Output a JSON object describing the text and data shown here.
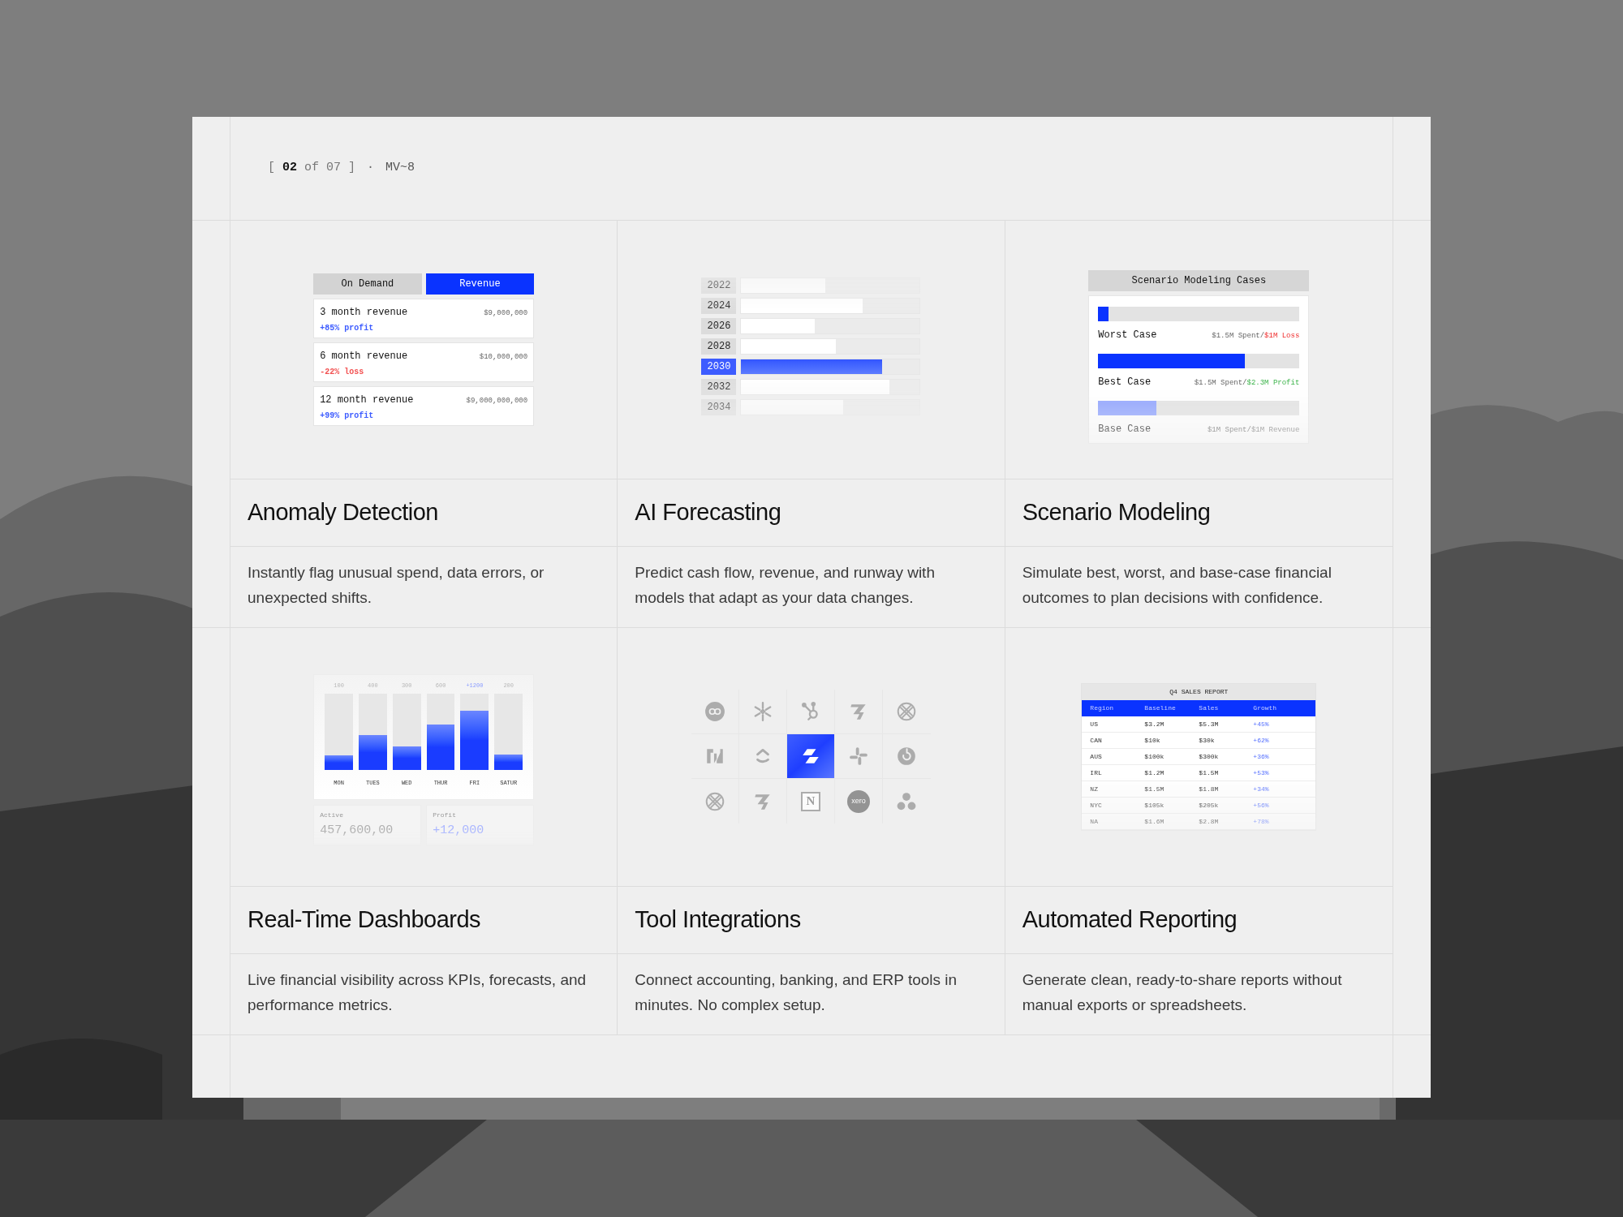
{
  "pager": {
    "text": "[ **02** of 07 ]",
    "separator": "·",
    "code": "MV~8"
  },
  "features": [
    {
      "title": "Anomaly Detection",
      "description": "Instantly flag unusual spend, data errors, or unexpected shifts.",
      "illustration": {
        "kind": "revenue-tabs",
        "tabs": [
          {
            "label": "On Demand",
            "selected": false
          },
          {
            "label": "Revenue",
            "selected": true
          }
        ],
        "rows": [
          {
            "label": "3 month revenue",
            "amount": "$9,000,000",
            "change": "+85% profit",
            "color": "#3d5cff"
          },
          {
            "label": "6 month revenue",
            "amount": "$10,000,000",
            "change": "-22% loss",
            "color": "#f25050"
          },
          {
            "label": "12 month revenue",
            "amount": "$9,000,000,000",
            "change": "+99% profit",
            "color": "#3d5cff"
          }
        ]
      }
    },
    {
      "title": "AI Forecasting",
      "description": "Predict cash flow, revenue, and runway with models that adapt as your data changes.",
      "illustration": {
        "kind": "year-bars",
        "years": [
          {
            "label": "2022",
            "level": 0.47,
            "selected": false
          },
          {
            "label": "2024",
            "level": 0.68,
            "selected": false
          },
          {
            "label": "2026",
            "level": 0.41,
            "selected": false
          },
          {
            "label": "2028",
            "level": 0.53,
            "selected": false
          },
          {
            "label": "2030",
            "level": 0.79,
            "selected": true
          },
          {
            "label": "2032",
            "level": 0.83,
            "selected": false
          },
          {
            "label": "2034",
            "level": 0.57,
            "selected": false
          }
        ]
      }
    },
    {
      "title": "Scenario Modeling",
      "description": "Simulate best, worst, and base-case financial outcomes to plan decisions with confidence.",
      "illustration": {
        "kind": "scenarios",
        "title": "Scenario Modeling Cases",
        "cases": [
          {
            "name": "Worst Case",
            "spent": "$1.5M Spent/",
            "result": "$1M Loss",
            "kind": "loss",
            "level": 0.05
          },
          {
            "name": "Best Case",
            "spent": "$1.5M Spent/",
            "result": "$2.3M Profit",
            "kind": "profit",
            "level": 0.73
          },
          {
            "name": "Base Case",
            "spent": "$1M Spent/",
            "result": "$1M Revenue",
            "kind": "revenue",
            "level": 0.29
          }
        ]
      }
    },
    {
      "title": "Real-Time Dashboards",
      "description": "Live financial visibility across KPIs, forecasts, and performance metrics.",
      "illustration": {
        "kind": "day-bars",
        "bars": [
          {
            "value": "100",
            "day": "MON",
            "level": 0.19,
            "highlighted": false
          },
          {
            "value": "400",
            "day": "TUES",
            "level": 0.46,
            "highlighted": false
          },
          {
            "value": "300",
            "day": "WED",
            "level": 0.31,
            "highlighted": false
          },
          {
            "value": "600",
            "day": "THUR",
            "level": 0.6,
            "highlighted": false
          },
          {
            "value": "+1200",
            "day": "FRI",
            "level": 0.78,
            "highlighted": true
          },
          {
            "value": "200",
            "day": "SATUR",
            "level": 0.2,
            "highlighted": false
          }
        ],
        "stats": [
          {
            "label": "Active",
            "value": "457,600,00",
            "highlighted": false
          },
          {
            "label": "Profit",
            "value": "+12,000",
            "highlighted": true
          }
        ]
      }
    },
    {
      "title": "Tool Integrations",
      "description": "Connect accounting, banking, and ERP tools in minutes. No complex setup.",
      "illustration": {
        "kind": "logo-grid",
        "tiles": [
          {
            "kind": "circle-badge",
            "selected": false
          },
          {
            "kind": "snowflake",
            "selected": false
          },
          {
            "kind": "hub",
            "selected": false
          },
          {
            "kind": "z-mark",
            "selected": false
          },
          {
            "kind": "lattice",
            "selected": false
          },
          {
            "kind": "bracket-mark",
            "selected": false
          },
          {
            "kind": "chevrons",
            "selected": false
          },
          {
            "kind": "app-mark",
            "selected": true
          },
          {
            "kind": "pinwheel",
            "selected": false
          },
          {
            "kind": "circle-arrow",
            "selected": false
          },
          {
            "kind": "lattice",
            "selected": false
          },
          {
            "kind": "z-mark",
            "selected": false
          },
          {
            "kind": "letter-tile",
            "label": "N",
            "selected": false
          },
          {
            "kind": "word-circle",
            "label": "xero",
            "selected": false
          },
          {
            "kind": "dots",
            "selected": false
          }
        ]
      }
    },
    {
      "title": "Automated Reporting",
      "description": "Generate clean, ready-to-share reports without manual exports or spreadsheets.",
      "illustration": {
        "kind": "report-table",
        "title": "Q4 SALES REPORT",
        "columns": [
          "Region",
          "Baseline",
          "Sales",
          "Growth"
        ],
        "rows": [
          [
            "US",
            "$3.2M",
            "$5.3M",
            "+45%"
          ],
          [
            "CAN",
            "$10k",
            "$30k",
            "+62%"
          ],
          [
            "AUS",
            "$100k",
            "$300k",
            "+36%"
          ],
          [
            "IRL",
            "$1.2M",
            "$1.5M",
            "+53%"
          ],
          [
            "NZ",
            "$1.5M",
            "$1.8M",
            "+34%"
          ],
          [
            "NYC",
            "$105k",
            "$205k",
            "+56%"
          ],
          [
            "NA",
            "$1.6M",
            "$2.8M",
            "+78%"
          ]
        ]
      }
    }
  ]
}
